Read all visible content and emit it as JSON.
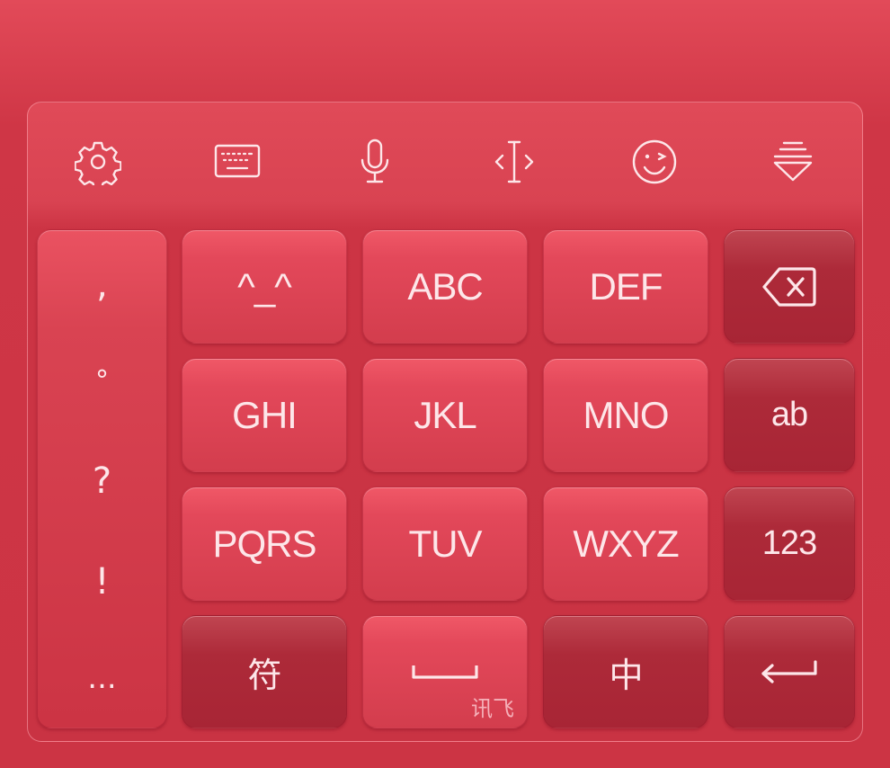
{
  "toolbar": {
    "icons": [
      "gear-icon",
      "keyboard-icon",
      "microphone-icon",
      "text-cursor-icon",
      "emoji-wink-icon",
      "collapse-keyboard-icon"
    ]
  },
  "punctuation": [
    ",",
    "°",
    "?",
    "!",
    "..."
  ],
  "keys": {
    "emoticon": "^_^",
    "abc": "ABC",
    "def": "DEF",
    "ghi": "GHI",
    "jkl": "JKL",
    "mno": "MNO",
    "pqrs": "PQRS",
    "tuv": "TUV",
    "wxyz": "WXYZ",
    "ab": "ab",
    "num": "123",
    "symbol": "符",
    "space_brand": "讯飞",
    "chinese": "中"
  },
  "colors": {
    "background": "#cc3444",
    "key_light": "#e3485a",
    "key_dark": "#a82535",
    "text": "#fde6e9"
  }
}
